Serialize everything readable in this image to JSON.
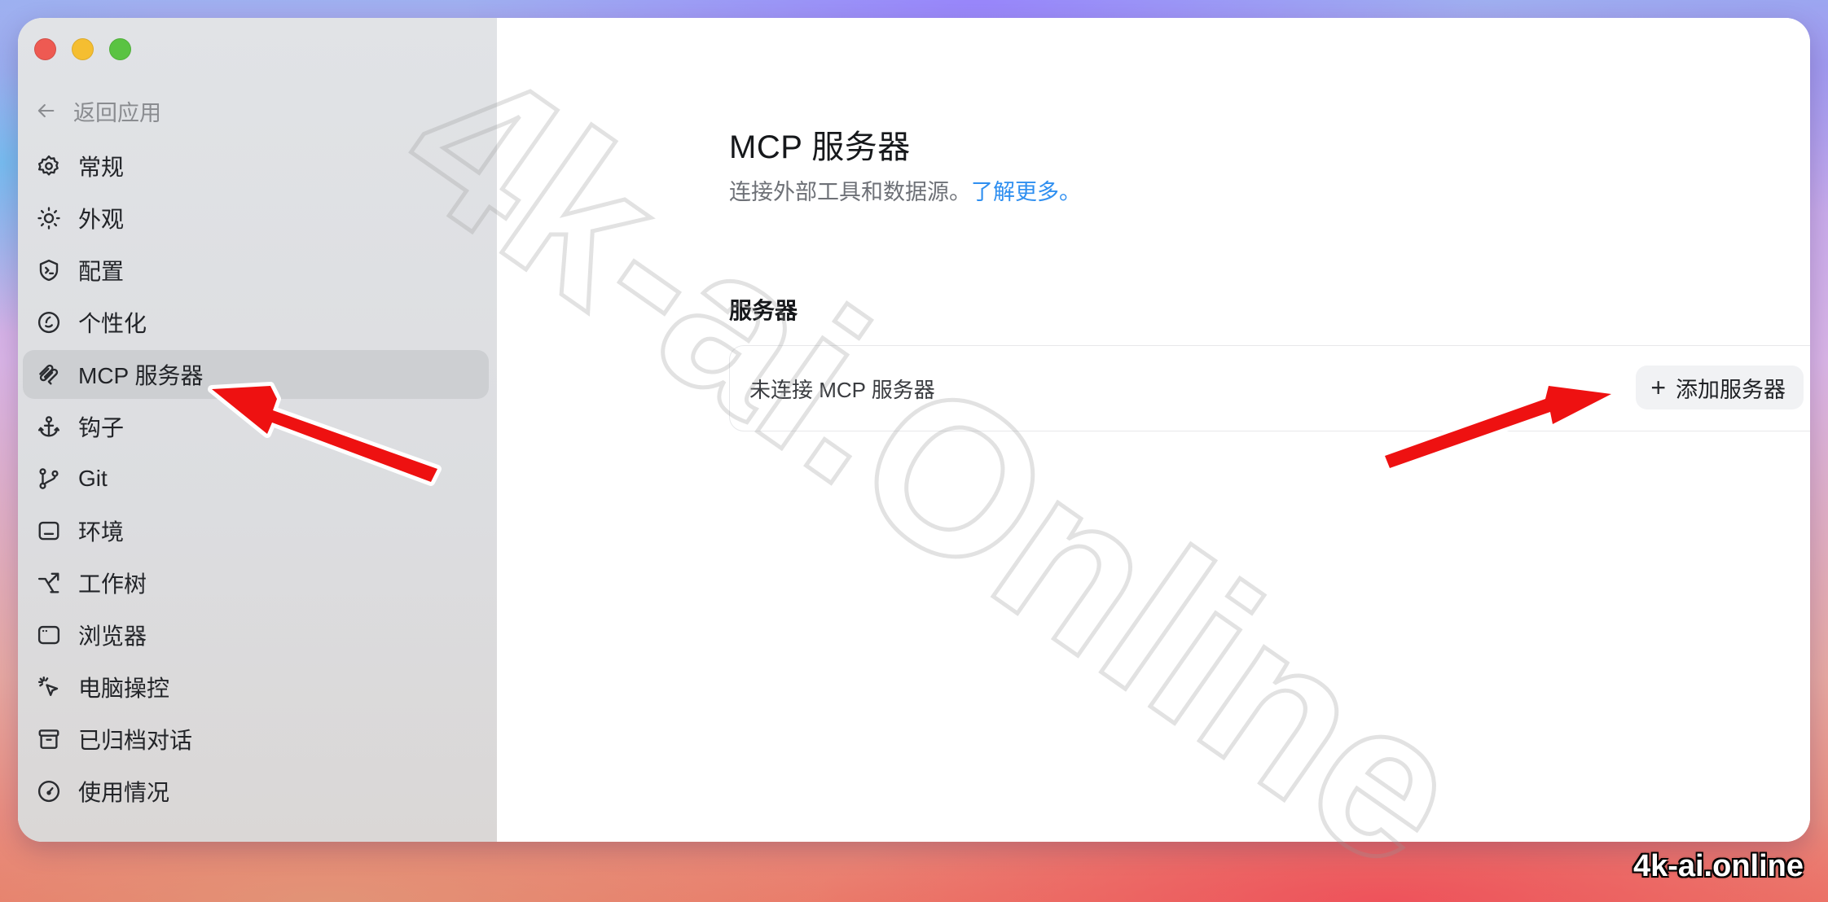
{
  "window": {
    "traffic_lights": [
      "close",
      "minimize",
      "zoom"
    ]
  },
  "sidebar": {
    "back_label": "返回应用",
    "items": [
      {
        "label": "常规",
        "icon": "gear-icon"
      },
      {
        "label": "外观",
        "icon": "sun-icon"
      },
      {
        "label": "配置",
        "icon": "shield-terminal-icon"
      },
      {
        "label": "个性化",
        "icon": "face-icon"
      },
      {
        "label": "MCP 服务器",
        "icon": "mcp-icon",
        "active": true
      },
      {
        "label": "钩子",
        "icon": "anchor-icon"
      },
      {
        "label": "Git",
        "icon": "git-branch-icon"
      },
      {
        "label": "环境",
        "icon": "environment-icon"
      },
      {
        "label": "工作树",
        "icon": "worktree-icon"
      },
      {
        "label": "浏览器",
        "icon": "browser-icon"
      },
      {
        "label": "电脑操控",
        "icon": "cursor-click-icon"
      },
      {
        "label": "已归档对话",
        "icon": "archive-icon"
      },
      {
        "label": "使用情况",
        "icon": "gauge-icon"
      }
    ]
  },
  "main": {
    "title": "MCP 服务器",
    "description": "连接外部工具和数据源。",
    "learn_more": "了解更多。",
    "section_label": "服务器",
    "empty_text": "未连接 MCP 服务器",
    "add_button": "添加服务器",
    "add_button_icon": "plus-icon"
  },
  "overlay": {
    "watermark_text": "4k-ai.Online",
    "corner_label": "4k-ai.online",
    "arrow_color": "#ee1111"
  }
}
